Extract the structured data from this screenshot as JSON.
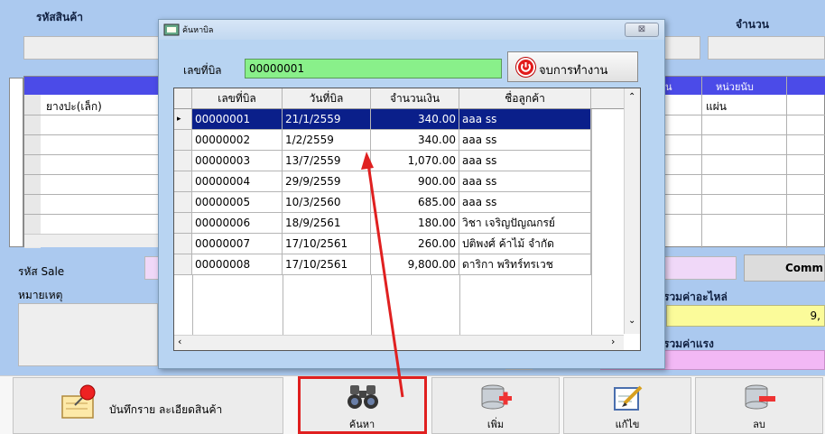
{
  "form": {
    "product_code_label": "รหัสสินค้า",
    "quantity_label": "จำนวน",
    "grid_header_unit": "หน่วยนับ",
    "grid_header_partial": "น",
    "grid_row1_name": "ยางปะ(เล็ก)",
    "grid_row1_unit": "แผ่น",
    "sale_code_label": "รหัส Sale",
    "comm_label": "Comm",
    "remarks_label": "หมายเหตุ",
    "parts_total_label": "รวมค่าอะไหล่",
    "parts_total_value": "9,",
    "labor_total_label": "รวมค่าแรง"
  },
  "toolbar": {
    "save_detail": "บันทึกราย ละเอียดสินค้า",
    "search": "ค้นหา",
    "add": "เพิ่ม",
    "edit": "แก้ไข",
    "delete": "ลบ"
  },
  "dialog": {
    "title": "ค้นหาบิล",
    "close_symbol": "⊠",
    "bill_no_label": "เลขที่บิล",
    "bill_no_value": "00000001",
    "end_button_label": "จบการทำงาน",
    "columns": [
      "เลขที่บิล",
      "วันที่บิล",
      "จำนวนเงิน",
      "ชื่อลูกค้า"
    ],
    "rows": [
      {
        "bill": "00000001",
        "date": "21/1/2559",
        "amount": "340.00",
        "customer": "aaa ss"
      },
      {
        "bill": "00000002",
        "date": "1/2/2559",
        "amount": "340.00",
        "customer": "aaa ss"
      },
      {
        "bill": "00000003",
        "date": "13/7/2559",
        "amount": "1,070.00",
        "customer": "aaa ss"
      },
      {
        "bill": "00000004",
        "date": "29/9/2559",
        "amount": "900.00",
        "customer": "aaa ss"
      },
      {
        "bill": "00000005",
        "date": "10/3/2560",
        "amount": "685.00",
        "customer": "aaa ss"
      },
      {
        "bill": "00000006",
        "date": "18/9/2561",
        "amount": "180.00",
        "customer": "วิชา เจริญปัญณกรย์"
      },
      {
        "bill": "00000007",
        "date": "17/10/2561",
        "amount": "260.00",
        "customer": "ปติพงศ์  ค้าไม้ จำกัด"
      },
      {
        "bill": "00000008",
        "date": "17/10/2561",
        "amount": "9,800.00",
        "customer": "ดาริกา พริทร์ทรเวช"
      }
    ]
  },
  "colors": {
    "selected_row": "#0a1f8a",
    "highlight_box": "#e02020",
    "arrow": "#e02020",
    "bill_input_bg": "#89f08a"
  }
}
